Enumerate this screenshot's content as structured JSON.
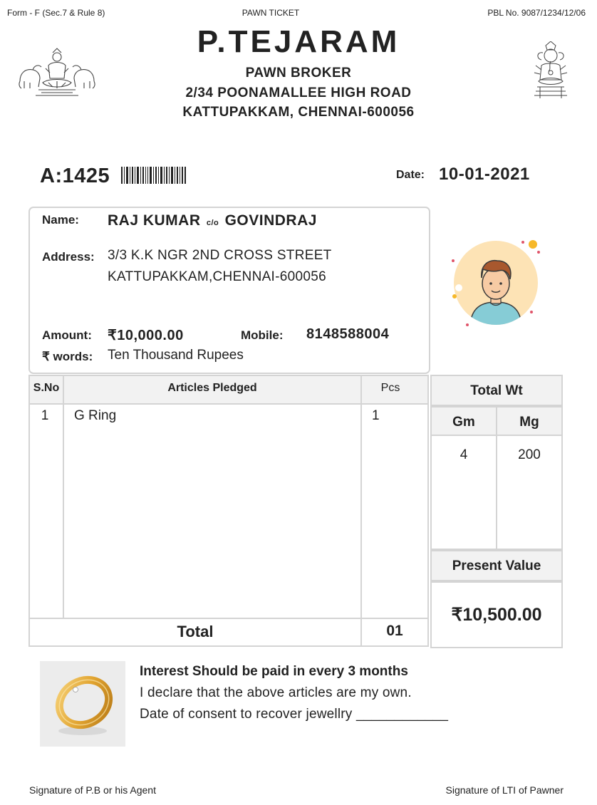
{
  "header": {
    "form_label": "Form - F (Sec.7 & Rule 8)",
    "doc_type": "PAWN TICKET",
    "license_no": "PBL No. 9087/1234/12/06",
    "business_name": "P.TEJARAM",
    "business_type": "PAWN BROKER",
    "address_line1": "2/34 POONAMALLEE HIGH ROAD",
    "address_line2": "KATTUPAKKAM, CHENNAI-600056"
  },
  "ticket": {
    "number": "A:1425",
    "date_label": "Date:",
    "date": "10-01-2021"
  },
  "customer": {
    "name_label": "Name:",
    "name": "RAJ KUMAR",
    "care_of": "c/o",
    "guardian": "GOVINDRAJ",
    "address_label": "Address:",
    "address_line1": "3/3 K.K NGR 2ND CROSS STREET",
    "address_line2": "KATTUPAKKAM,CHENNAI-600056",
    "amount_label": "Amount:",
    "amount": "₹10,000.00",
    "mobile_label": "Mobile:",
    "mobile": "8148588004",
    "words_label": "₹ words:",
    "words": "Ten Thousand Rupees"
  },
  "table": {
    "col_sno": "S.No",
    "col_articles": "Articles Pledged",
    "col_pcs": "Pcs",
    "rows": [
      {
        "sno": "1",
        "article": "G Ring",
        "pcs": "1"
      }
    ],
    "total_label": "Total",
    "total_pcs": "01"
  },
  "weight": {
    "title": "Total Wt",
    "gm_label": "Gm",
    "mg_label": "Mg",
    "gm": "4",
    "mg": "200",
    "present_value_label": "Present Value",
    "present_value": "₹10,500.00"
  },
  "declaration": {
    "interest": "Interest Should be paid in every 3 months",
    "declare": "I declare that the above articles are my own.",
    "consent": "Date of consent to recover jewellry ____________"
  },
  "footer": {
    "sig_pb": "Signature of P.B or his Agent",
    "sig_pawner": "Signature of LTI of Pawner"
  },
  "icons": {
    "left_emblem": "lakshmi-emblem",
    "right_emblem": "ganesha-emblem",
    "barcode": "barcode-icon",
    "avatar": "user-avatar",
    "item_photo": "gold-ring-photo"
  }
}
